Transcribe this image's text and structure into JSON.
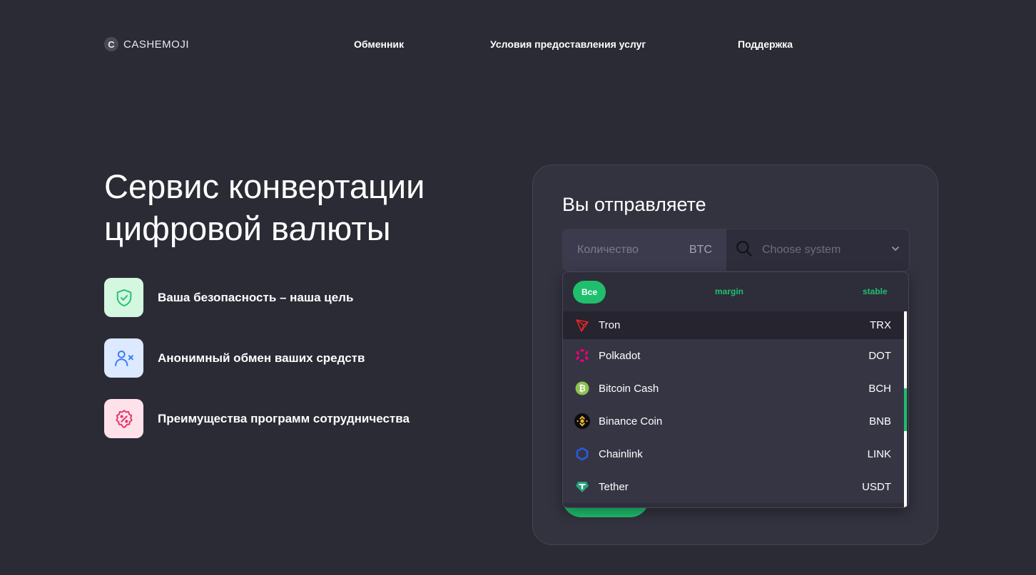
{
  "header": {
    "logo_letter": "C",
    "logo_text": "CASHEMOJI",
    "nav": [
      {
        "label": "Обменник"
      },
      {
        "label": "Условия предоставления услуг"
      },
      {
        "label": "Поддержка"
      }
    ]
  },
  "hero": {
    "title_line1": "Сервис конвертации",
    "title_line2": "цифровой валюты",
    "features": [
      {
        "text": "Ваша безопасность – наша цель",
        "icon": "shield-check-icon",
        "bg": "#d4f7df",
        "color": "#1fbf6d"
      },
      {
        "text": "Анонимный обмен ваших средств",
        "icon": "user-x-icon",
        "bg": "#dce9ff",
        "color": "#3e7bfa"
      },
      {
        "text": "Преимущества программ сотрудничества",
        "icon": "discount-badge-icon",
        "bg": "#ffe1ea",
        "color": "#e3386b"
      }
    ]
  },
  "exchange": {
    "title": "Вы отправляете",
    "amount_placeholder": "Количество",
    "amount_unit": "BTC",
    "system_placeholder": "Choose system",
    "filters": {
      "all": "Все",
      "margin": "margin",
      "stable": "stable"
    },
    "coins": [
      {
        "name": "Tron",
        "code": "TRX",
        "icon": "tron-icon",
        "color": "#e5262b"
      },
      {
        "name": "Polkadot",
        "code": "DOT",
        "icon": "polkadot-icon",
        "color": "#e6007a"
      },
      {
        "name": "Bitcoin Cash",
        "code": "BCH",
        "icon": "bitcoin-cash-icon",
        "color": "#8dc351"
      },
      {
        "name": "Binance Coin",
        "code": "BNB",
        "icon": "binance-coin-icon",
        "color": "#f3ba2f"
      },
      {
        "name": "Chainlink",
        "code": "LINK",
        "icon": "chainlink-icon",
        "color": "#2a5ada"
      },
      {
        "name": "Tether",
        "code": "USDT",
        "icon": "tether-icon",
        "color": "#26a17b"
      }
    ]
  },
  "colors": {
    "background": "#2b2b36",
    "accent": "#1fbf6d",
    "card": "#33323f"
  }
}
